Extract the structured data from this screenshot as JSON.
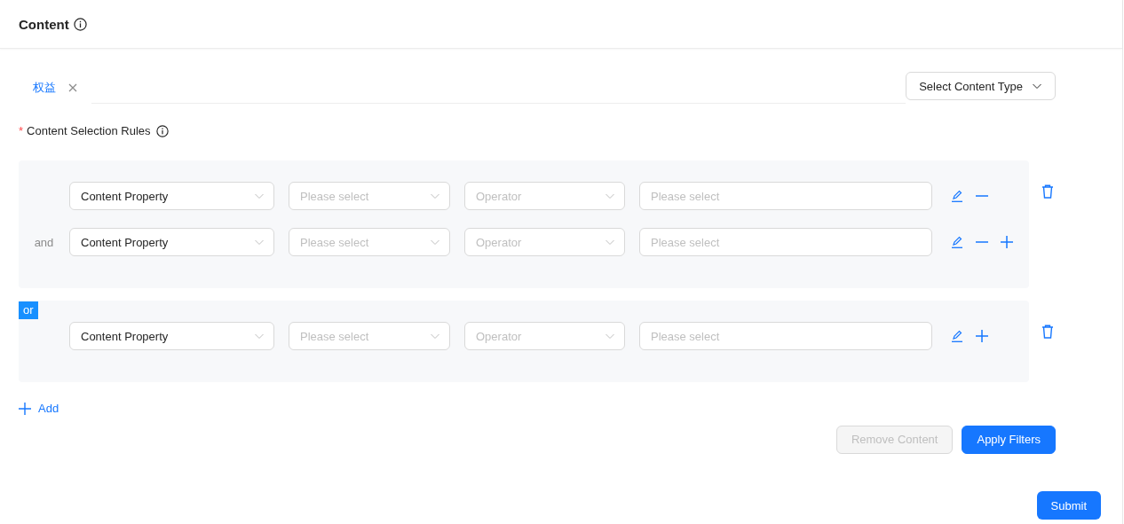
{
  "header": {
    "title": "Content"
  },
  "tabs": [
    {
      "label": "权益",
      "selected": true,
      "closable": true
    }
  ],
  "content_type_button": "Select Content Type",
  "rules_label": {
    "text": "Content Selection Rules",
    "required_mark": "*"
  },
  "groups": [
    {
      "rows": [
        {
          "field": "Content Property",
          "property_placeholder": "Please select",
          "operator_placeholder": "Operator",
          "value_placeholder": "Please select",
          "actions": [
            {
              "kind": "edit"
            },
            {
              "kind": "remove"
            }
          ]
        },
        {
          "logic": "and",
          "field": "Content Property",
          "property_placeholder": "Please select",
          "operator_placeholder": "Operator",
          "value_placeholder": "Please select",
          "actions": [
            {
              "kind": "edit"
            },
            {
              "kind": "remove"
            },
            {
              "kind": "add"
            }
          ]
        }
      ]
    },
    {
      "connector": "or",
      "rows": [
        {
          "field": "Content Property",
          "property_placeholder": "Please select",
          "operator_placeholder": "Operator",
          "value_placeholder": "Please select",
          "actions": [
            {
              "kind": "edit"
            },
            {
              "kind": "add"
            }
          ]
        }
      ]
    }
  ],
  "add_link": "Add",
  "buttons": [
    {
      "label": "Remove Content",
      "kind": "default",
      "disabled": true
    },
    {
      "label": "Apply Filters",
      "kind": "primary",
      "disabled": false
    }
  ],
  "submit": "Submit"
}
